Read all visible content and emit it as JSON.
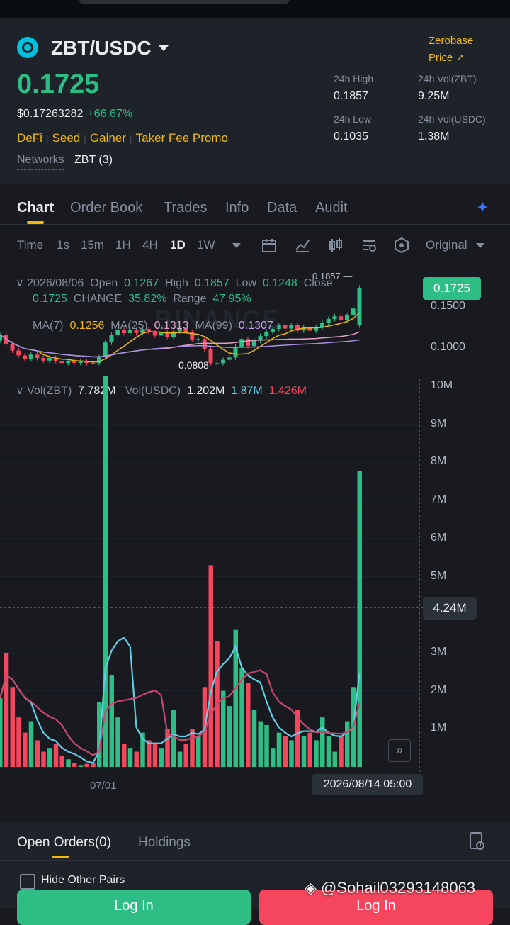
{
  "header": {
    "pair": "ZBT/USDC",
    "price": "0.1725",
    "usd_price": "$0.17263282",
    "change": "+66.67%",
    "tags": [
      "DeFi",
      "Seed",
      "Gainer",
      "Taker Fee Promo"
    ],
    "networks_label": "Networks",
    "networks_value": "ZBT (3)",
    "link_line1": "Zerobase",
    "link_line2": "Price ↗",
    "stats": {
      "high_label": "24h High",
      "high_value": "0.1857",
      "low_label": "24h Low",
      "low_value": "0.1035",
      "vol_zbt_label": "24h Vol(ZBT)",
      "vol_zbt_value": "9.25M",
      "vol_usdc_label": "24h Vol(USDC)",
      "vol_usdc_value": "1.38M"
    }
  },
  "tabs": [
    "Chart",
    "Order Book",
    "Trades",
    "Info",
    "Data",
    "Audit"
  ],
  "timeframes": [
    "Time",
    "1s",
    "15m",
    "1H",
    "4H",
    "1D",
    "1W"
  ],
  "view_mode": "Original",
  "ohlc": {
    "date": "2026/08/06",
    "open_label": "Open",
    "open": "0.1267",
    "high_label": "High",
    "high": "0.1857",
    "low_label": "Low",
    "low": "0.1248",
    "close_label": "Close",
    "close": "0.1725",
    "change_label": "CHANGE",
    "change": "35.82%",
    "range_label": "Range",
    "range": "47.95%"
  },
  "ma": {
    "ma7_label": "MA(7)",
    "ma7": "0.1256",
    "ma25_label": "MA(25)",
    "ma25": "0.1313",
    "ma99_label": "MA(99)",
    "ma99": "0.1307"
  },
  "price_axis": [
    "0.1500",
    "0.1000"
  ],
  "price_tag": "0.1725",
  "peak_label": "0.1857",
  "trough_label": "0.0808",
  "volume": {
    "label": "Vol(ZBT)",
    "value": "7.782M",
    "usdc_label": "Vol(USDC)",
    "usdc_value": "1.202M",
    "ma_a": "1.87M",
    "ma_b": "1.426M"
  },
  "volume_axis": [
    "10M",
    "9M",
    "8M",
    "7M",
    "6M",
    "5M",
    "4M",
    "3M",
    "2M",
    "1M"
  ],
  "crosshair_value": "4.24M",
  "crosshair_date": "2026/08/14 05:00",
  "x_axis_label": "07/01",
  "bottom": {
    "tab_open_orders": "Open Orders(0)",
    "tab_holdings": "Holdings",
    "hide_pairs": "Hide Other Pairs",
    "buy_label": "Log In",
    "sell_label": "Log In"
  },
  "watermark": "@Sohail03293148063",
  "colors": {
    "up": "#2ebd85",
    "down": "#f6465d",
    "accent": "#f0b90b",
    "bg": "#181a20"
  },
  "chart_data": {
    "type": "bar",
    "title": "",
    "ylabel": "",
    "ylim": [
      0,
      10000000
    ],
    "series": [
      {
        "name": "Vol(ZBT)",
        "values": [
          1800000,
          3000000,
          2100000,
          1300000,
          900000,
          1200000,
          700000,
          400000,
          500000,
          600000,
          300000,
          200000,
          100000,
          50000,
          80000,
          100000,
          1700000,
          11000000,
          2400000,
          1300000,
          600000,
          500000,
          400000,
          900000,
          700000,
          600000,
          500000,
          1000000,
          1500000,
          400000,
          600000,
          1000000,
          800000,
          2100000,
          5300000,
          3300000,
          2000000,
          1600000,
          3600000,
          2600000,
          2200000,
          1500000,
          1200000,
          1100000,
          500000,
          900000,
          800000,
          700000,
          1500000,
          800000,
          900000,
          700000,
          1300000,
          800000,
          400000,
          800000,
          1200000,
          2100000,
          7782000
        ],
        "up": [
          1,
          0,
          0,
          0,
          0,
          1,
          0,
          0,
          1,
          0,
          0,
          1,
          0,
          1,
          0,
          0,
          1,
          1,
          1,
          1,
          0,
          1,
          0,
          1,
          0,
          0,
          1,
          0,
          1,
          1,
          0,
          0,
          1,
          0,
          0,
          0,
          1,
          1,
          1,
          1,
          0,
          1,
          1,
          1,
          1,
          1,
          0,
          1,
          0,
          1,
          0,
          1,
          1,
          1,
          1,
          0,
          1,
          1,
          1
        ]
      }
    ],
    "ma_lines": [
      {
        "name": "1.87M",
        "color": "#5fcde4"
      },
      {
        "name": "1.426M",
        "color": "#c9486f"
      }
    ]
  }
}
